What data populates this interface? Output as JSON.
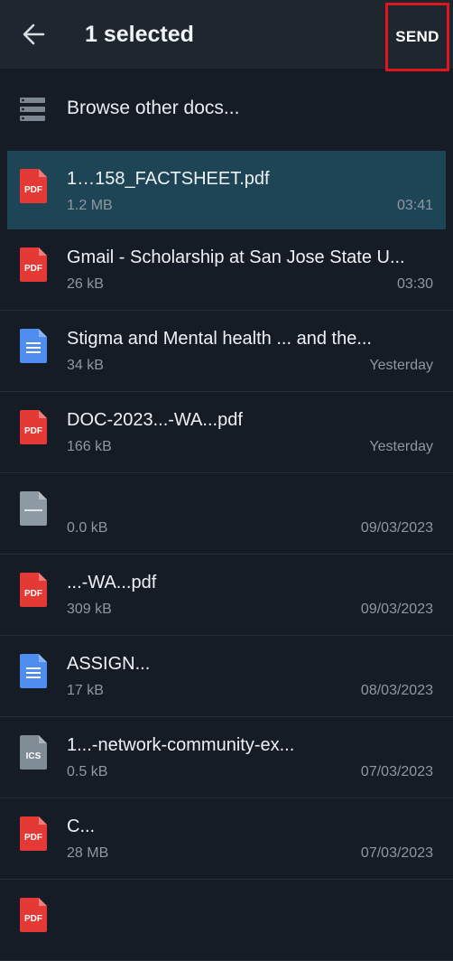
{
  "header": {
    "title": "1 selected",
    "send_label": "SEND"
  },
  "browse": {
    "label": "Browse other docs..."
  },
  "colors": {
    "pdf": "#e53935",
    "doc": "#4f8ef0",
    "ics": "#7f8b95",
    "generic": "#8e9aa3",
    "send_outline": "#e0161c",
    "selected_row": "#1d4556"
  },
  "files": [
    {
      "type": "pdf",
      "icon_label": "PDF",
      "name": "1…158_FACTSHEET.pdf",
      "size": "1.2 MB",
      "date": "03:41",
      "selected": true
    },
    {
      "type": "pdf",
      "icon_label": "PDF",
      "name": "Gmail - Scholarship at San Jose State U...",
      "size": "26 kB",
      "date": "03:30",
      "selected": false
    },
    {
      "type": "doc",
      "icon_label": "",
      "name": "Stigma and Mental health ... and the...",
      "size": "34 kB",
      "date": "Yesterday",
      "selected": false
    },
    {
      "type": "pdf",
      "icon_label": "PDF",
      "name": "DOC-2023...-WA...pdf",
      "size": "166 kB",
      "date": "Yesterday",
      "selected": false
    },
    {
      "type": "generic",
      "icon_label": "",
      "name": "",
      "size": "0.0 kB",
      "date": "09/03/2023",
      "selected": false
    },
    {
      "type": "pdf",
      "icon_label": "PDF",
      "name": "...-WA...pdf",
      "size": "309 kB",
      "date": "09/03/2023",
      "selected": false
    },
    {
      "type": "doc",
      "icon_label": "",
      "name": "ASSIGN...",
      "size": "17 kB",
      "date": "08/03/2023",
      "selected": false
    },
    {
      "type": "ics",
      "icon_label": "ICS",
      "name": "1...-network-community-ex...",
      "size": "0.5 kB",
      "date": "07/03/2023",
      "selected": false
    },
    {
      "type": "pdf",
      "icon_label": "PDF",
      "name": "C...",
      "size": "28 MB",
      "date": "07/03/2023",
      "selected": false
    },
    {
      "type": "pdf",
      "icon_label": "PDF",
      "name": "",
      "size": "",
      "date": "",
      "selected": false
    }
  ]
}
